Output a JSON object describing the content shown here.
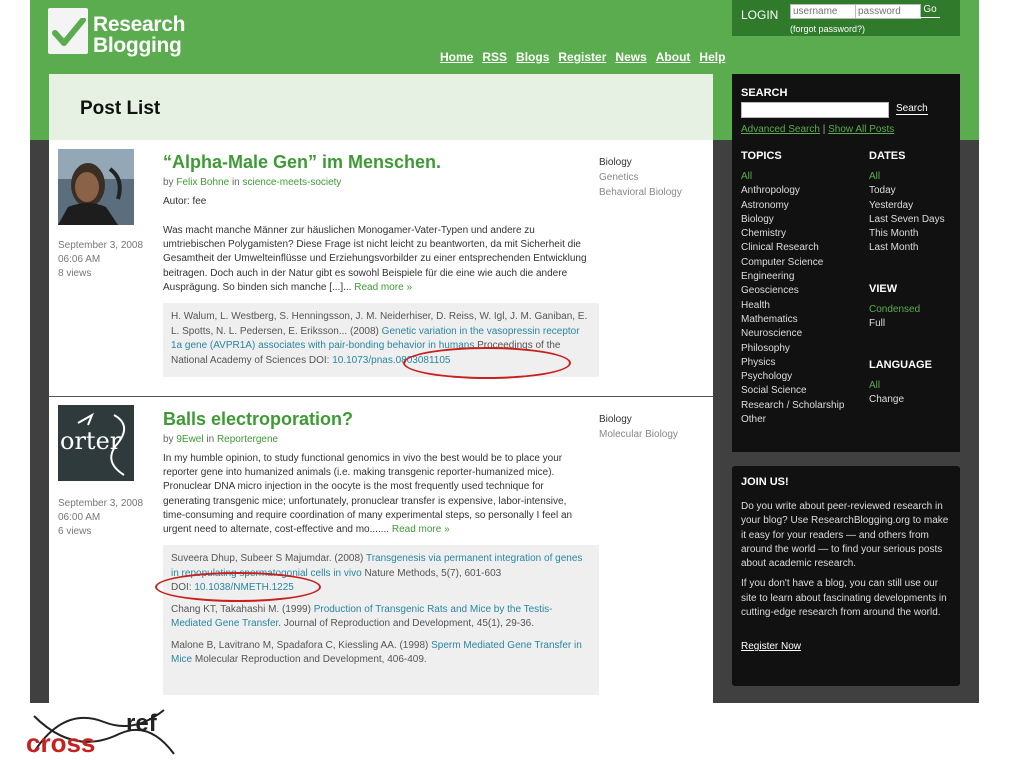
{
  "brand": {
    "line1": "Research",
    "line2": "Blogging",
    "green": "#5aac4e",
    "dark_green": "#2f7a2b"
  },
  "nav": [
    "Home",
    "RSS",
    "Blogs",
    "Register",
    "News",
    "About",
    "Help"
  ],
  "login": {
    "label": "LOGIN",
    "username_placeholder": "username",
    "password_placeholder": "password",
    "go": "Go",
    "forgot": "(forgot password?)"
  },
  "page_title": "Post List",
  "posts": [
    {
      "title": "“Alpha-Male Gen” im Menschen.",
      "by_prefix": "by",
      "author": "Felix Bohne",
      "in_word": "in",
      "blog": "science-meets-society",
      "date": "September 3, 2008",
      "time": "06:06 AM",
      "views": "8 views",
      "categories": [
        "Biology",
        "Genetics",
        "Behavioral Biology"
      ],
      "autor_line": "Autor: fee",
      "body": "Was macht manche Männer zur häuslichen Monogamer-Vater-Typen und andere zu umtriebischen Polygamisten? Diese Frage ist nicht leicht zu beantworten, da mit Sicherheit die Gesamtheit der Umwelteinflüsse und Erziehungsvorbilder zu einer entsprechenden Entwicklung beitragen. Doch auch in der Natur gibt es sowohl Beispiele für die eine wie auch die andere Ausprägung. So binden sich manche [...]...",
      "read_more": "Read more »",
      "citation": {
        "authors": "H. Walum, L. Westberg, S. Henningsson, J. M. Neiderhiser, D. Reiss, W. Igl, J. M. Ganiban, E. L. Spotts, N. L. Pedersen, E. Eriksson... (2008)",
        "title": "Genetic variation in the vasopressin receptor 1a gene (AVPR1A) associates with pair-bonding behavior in humans",
        "journal": "Proceedings of the National Academy of Sciences",
        "doi_label": "DOI:",
        "doi": "10.1073/pnas.0803081105"
      }
    },
    {
      "title": "Balls electroporation?",
      "by_prefix": "by",
      "author": "9Ewel",
      "in_word": "in",
      "blog": "Reportergene",
      "date": "September 3, 2008",
      "time": "06:00 AM",
      "views": "6 views",
      "categories": [
        "Biology",
        "Molecular Biology"
      ],
      "body": "In my humble opinion, to study functional genomics in vivo the best would be to place your reporter gene into humanized animals (i.e. making transgenic reporter-humanized mice). Pronuclear DNA micro injection in the oocyte is the most frequently used technique for generating transgenic mice; unfortunately, pronuclear transfer is expensive, labor-intensive, time-consuming and require coordination of many experimental steps, so personally I feel an urgent need to alternate, cost-effective and mo.......",
      "read_more": "Read more »",
      "citations": [
        {
          "authors": "Suveera Dhup, Subeer S Majumdar. (2008)",
          "title": "Transgenesis via permanent integration of genes in repopulating spermatogonial cells in vivo",
          "journal": "Nature Methods, 5(7), 601-603",
          "doi_label": "DOI:",
          "doi": "10.1038/NMETH.1225"
        },
        {
          "authors": "Chang KT, Takahashi M. (1999)",
          "title": "Production of Transgenic Rats and Mice by the Testis-Mediated Gene Transfer",
          "journal": "Journal of Reproduction and Development, 45(1), 29-36."
        },
        {
          "authors": "Malone B, Lavitrano M, Spadafora C, Kiessling AA. (1998)",
          "title": "Sperm Mediated Gene Transfer in Mice",
          "journal": "Molecular Reproduction and Development, 406-409."
        }
      ]
    }
  ],
  "sidebar": {
    "search": {
      "heading": "SEARCH",
      "button": "Search",
      "advanced": "Advanced Search",
      "sep": "|",
      "show_all": "Show All Posts"
    },
    "topics": {
      "heading": "TOPICS",
      "items": [
        "All",
        "Anthropology",
        "Astronomy",
        "Biology",
        "Chemistry",
        "Clinical Research",
        "Computer Science",
        "Engineering",
        "Geosciences",
        "Health",
        "Mathematics",
        "Neuroscience",
        "Philosophy",
        "Physics",
        "Psychology",
        "Social Science",
        "Research / Scholarship",
        "Other"
      ]
    },
    "dates": {
      "heading": "DATES",
      "items": [
        "All",
        "Today",
        "Yesterday",
        "Last Seven Days",
        "This Month",
        "Last Month"
      ]
    },
    "view": {
      "heading": "VIEW",
      "items": [
        "Condensed",
        "Full"
      ]
    },
    "language": {
      "heading": "LANGUAGE",
      "items": [
        "All",
        "Change"
      ]
    },
    "join": {
      "heading": "JOIN US!",
      "p1": "Do you write about peer-reviewed research in your blog? Use ResearchBlogging.org to make it easy for your readers — and others from around the world — to find your serious posts about academic research.",
      "p2": "If you don't have a blog, you can still use our site to learn about fascinating developments in cutting-edge research from around the world.",
      "register": "Register Now"
    }
  },
  "crossref": {
    "cross": "cross",
    "ref": "ref",
    "red": "#c8201c"
  }
}
